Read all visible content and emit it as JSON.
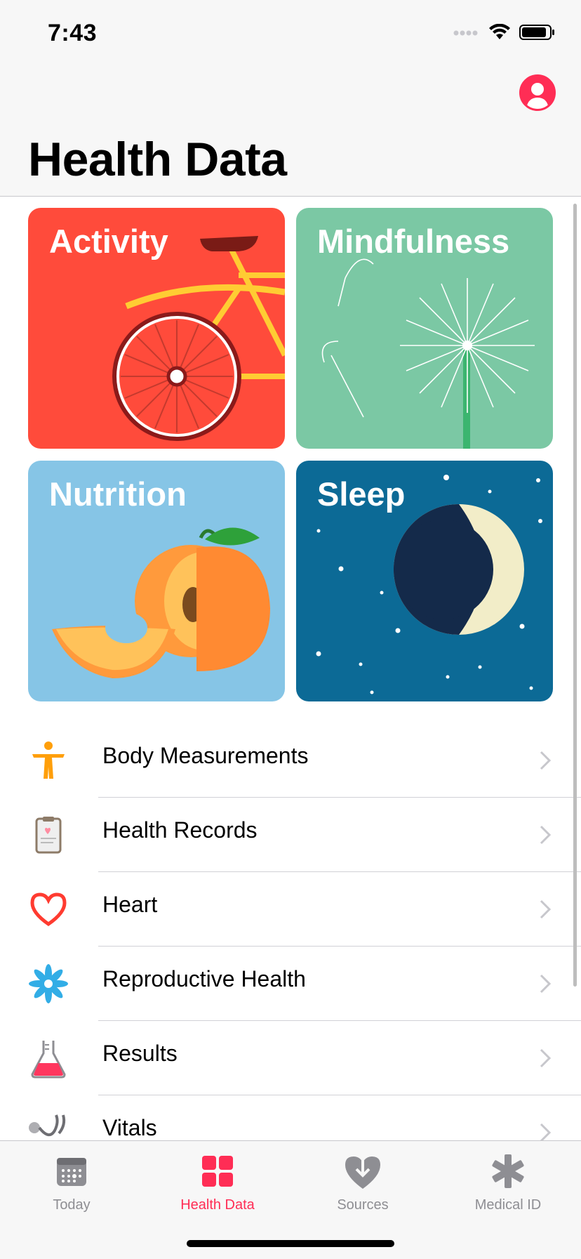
{
  "status": {
    "time": "7:43"
  },
  "header": {
    "title": "Health Data"
  },
  "tiles": [
    {
      "label": "Activity",
      "color": "#ff4b3b"
    },
    {
      "label": "Mindfulness",
      "color": "#7bc8a4"
    },
    {
      "label": "Nutrition",
      "color": "#86c5e6"
    },
    {
      "label": "Sleep",
      "color": "#0c6a96"
    }
  ],
  "list": [
    {
      "label": "Body Measurements",
      "icon": "body-figure-icon"
    },
    {
      "label": "Health Records",
      "icon": "clipboard-icon"
    },
    {
      "label": "Heart",
      "icon": "heart-icon"
    },
    {
      "label": "Reproductive Health",
      "icon": "flower-icon"
    },
    {
      "label": "Results",
      "icon": "flask-icon"
    },
    {
      "label": "Vitals",
      "icon": "stethoscope-icon"
    }
  ],
  "tabbar": {
    "items": [
      {
        "label": "Today",
        "icon": "calendar-icon",
        "active": false
      },
      {
        "label": "Health Data",
        "icon": "grid-icon",
        "active": true
      },
      {
        "label": "Sources",
        "icon": "heart-download-icon",
        "active": false
      },
      {
        "label": "Medical ID",
        "icon": "asterisk-icon",
        "active": false
      }
    ],
    "active_color": "#ff2d55",
    "inactive_color": "#8e8e93"
  },
  "accent": "#ff2d55"
}
